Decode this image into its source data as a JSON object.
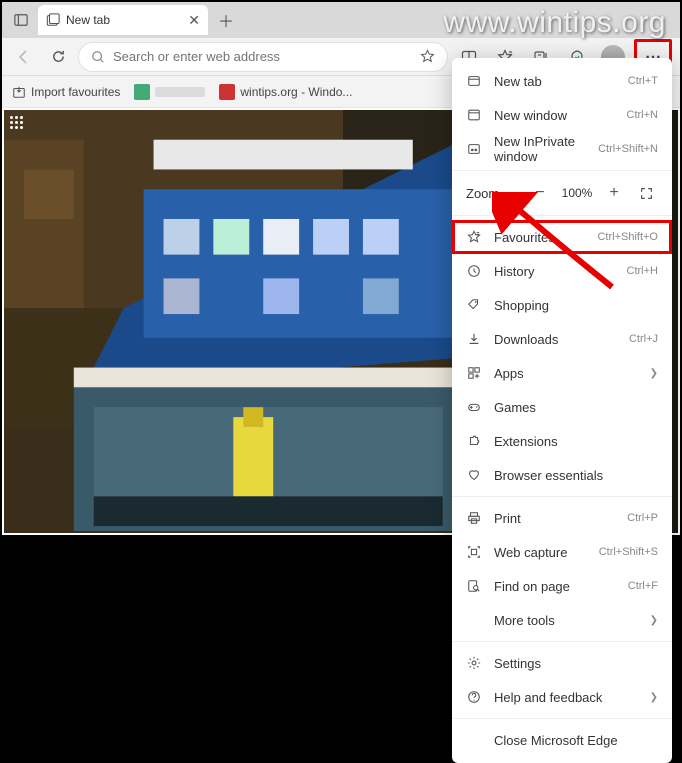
{
  "watermark": "www.wintips.org",
  "tab": {
    "title": "New tab"
  },
  "omnibox": {
    "placeholder": "Search or enter web address"
  },
  "bookmarks": {
    "import": "Import favourites",
    "wintips": "wintips.org - Windo..."
  },
  "menu": {
    "newtab": {
      "label": "New tab",
      "shortcut": "Ctrl+T"
    },
    "newwin": {
      "label": "New window",
      "shortcut": "Ctrl+N"
    },
    "inprivate": {
      "label": "New InPrivate window",
      "shortcut": "Ctrl+Shift+N"
    },
    "zoom": {
      "label": "Zoom",
      "value": "100%"
    },
    "favourites": {
      "label": "Favourites",
      "shortcut": "Ctrl+Shift+O"
    },
    "history": {
      "label": "History",
      "shortcut": "Ctrl+H"
    },
    "shopping": {
      "label": "Shopping",
      "shortcut": ""
    },
    "downloads": {
      "label": "Downloads",
      "shortcut": "Ctrl+J"
    },
    "apps": {
      "label": "Apps",
      "shortcut": ""
    },
    "games": {
      "label": "Games",
      "shortcut": ""
    },
    "extensions": {
      "label": "Extensions",
      "shortcut": ""
    },
    "essentials": {
      "label": "Browser essentials",
      "shortcut": ""
    },
    "print": {
      "label": "Print",
      "shortcut": "Ctrl+P"
    },
    "capture": {
      "label": "Web capture",
      "shortcut": "Ctrl+Shift+S"
    },
    "find": {
      "label": "Find on page",
      "shortcut": "Ctrl+F"
    },
    "moretools": {
      "label": "More tools",
      "shortcut": ""
    },
    "settings": {
      "label": "Settings",
      "shortcut": ""
    },
    "help": {
      "label": "Help and feedback",
      "shortcut": ""
    },
    "close": {
      "label": "Close Microsoft Edge",
      "shortcut": ""
    }
  }
}
